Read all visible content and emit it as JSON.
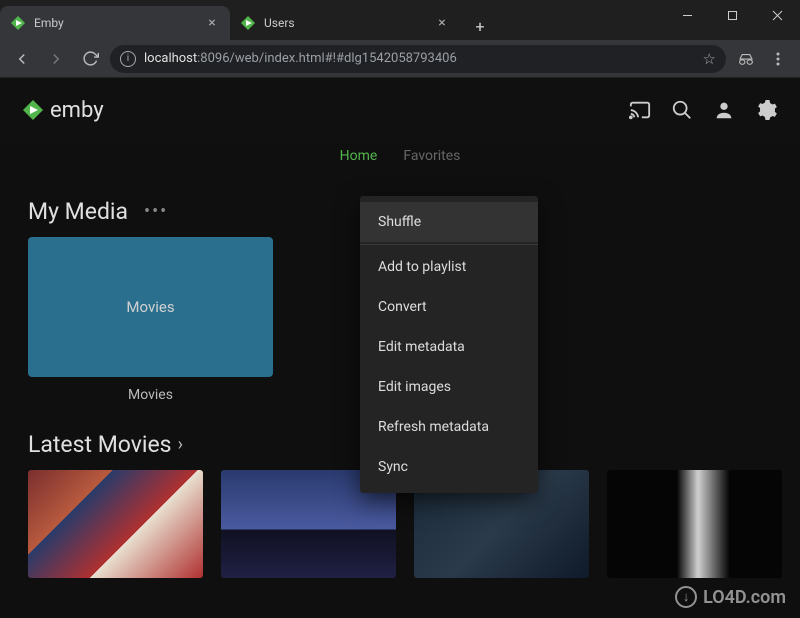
{
  "window": {
    "tabs": [
      {
        "title": "Emby",
        "active": true
      },
      {
        "title": "Users",
        "active": false
      }
    ]
  },
  "addressbar": {
    "host": "localhost",
    "rest": ":8096/web/index.html#!#dlg1542058793406"
  },
  "emby": {
    "brand": "emby",
    "nav": [
      {
        "label": "Home",
        "active": true
      },
      {
        "label": "Favorites",
        "active": false
      }
    ],
    "sections": {
      "my_media": {
        "title": "My Media",
        "tile_label": "Movies",
        "caption": "Movies"
      },
      "latest": {
        "title": "Latest Movies"
      }
    }
  },
  "context_menu": {
    "items": [
      "Shuffle",
      "Add to playlist",
      "Convert",
      "Edit metadata",
      "Edit images",
      "Refresh metadata",
      "Sync"
    ]
  },
  "watermark": "LO4D.com"
}
